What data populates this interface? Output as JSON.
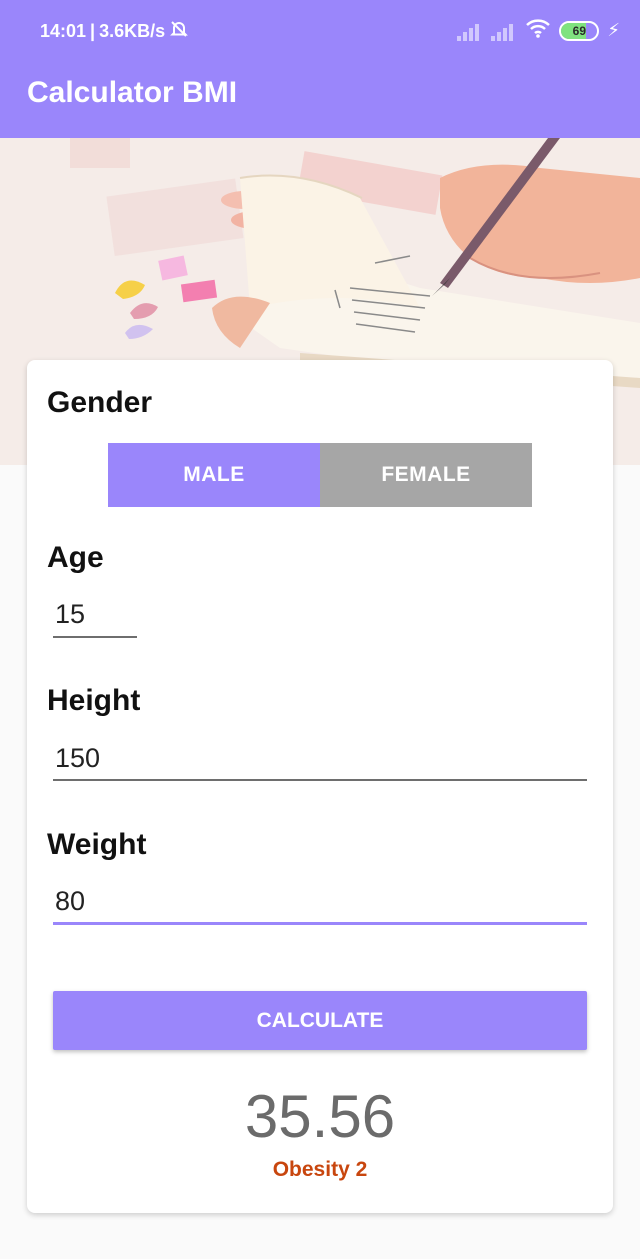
{
  "status_bar": {
    "time": "14:01",
    "net_speed": "3.6KB/s",
    "battery": "69"
  },
  "app_bar": {
    "title": "Calculator BMI"
  },
  "form": {
    "gender_label": "Gender",
    "gender_options": [
      "MALE",
      "FEMALE"
    ],
    "selected_gender": "MALE",
    "age_label": "Age",
    "age_value": "15",
    "height_label": "Height",
    "height_value": "150",
    "weight_label": "Weight",
    "weight_value": "80",
    "calculate_label": "CALCULATE"
  },
  "result": {
    "bmi": "35.56",
    "category": "Obesity 2",
    "category_color": "#c8460e"
  },
  "colors": {
    "accent": "#9a86fb",
    "inactive": "#a6a6a6"
  }
}
